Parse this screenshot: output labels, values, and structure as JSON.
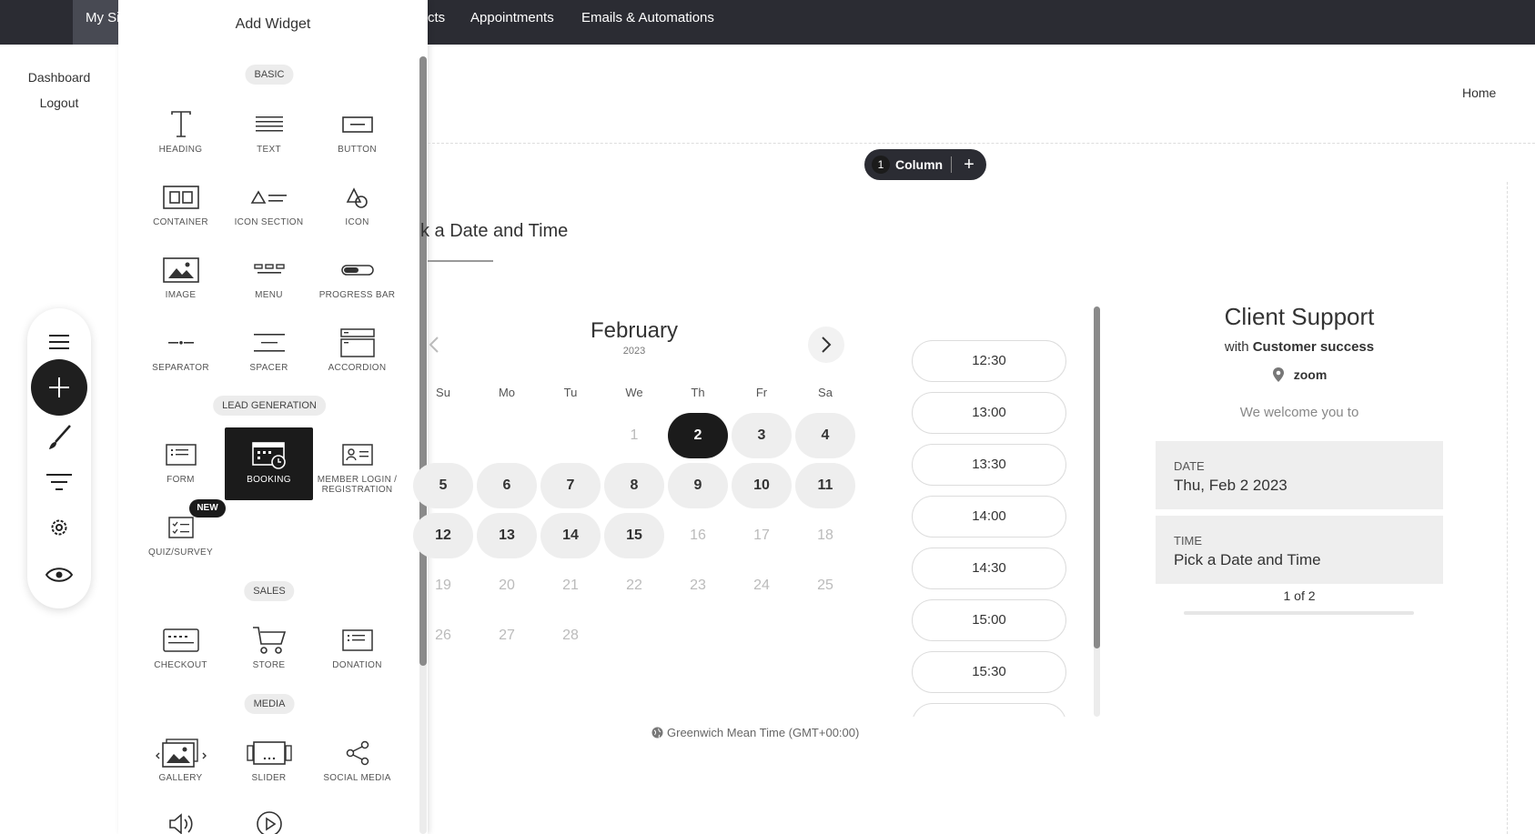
{
  "topbar": {
    "active_tab_label": "My Si",
    "partial_tab_label": "cts",
    "appointments_label": "Appointments",
    "emails_label": "Emails & Automations"
  },
  "left_links": {
    "dashboard": "Dashboard",
    "logout": "Logout"
  },
  "panel": {
    "title": "Add Widget",
    "sections": {
      "basic": "BASIC",
      "lead": "LEAD GENERATION",
      "sales": "SALES",
      "media": "MEDIA"
    },
    "widgets": {
      "heading": "HEADING",
      "text": "TEXT",
      "button": "BUTTON",
      "container": "CONTAINER",
      "icon_section": "ICON SECTION",
      "icon": "ICON",
      "image": "IMAGE",
      "menu": "MENU",
      "progress_bar": "PROGRESS BAR",
      "separator": "SEPARATOR",
      "spacer": "SPACER",
      "accordion": "ACCORDION",
      "form": "FORM",
      "booking": "BOOKING",
      "member_login": "MEMBER LOGIN / REGISTRATION",
      "quiz": "QUIZ/SURVEY",
      "checkout": "CHECKOUT",
      "store": "STORE",
      "donation": "DONATION",
      "gallery": "GALLERY",
      "slider": "SLIDER",
      "social_media": "SOCIAL MEDIA"
    },
    "new_badge": "NEW"
  },
  "page": {
    "home_link": "Home",
    "column_pill": {
      "count": "1",
      "label": "Column",
      "add": "+"
    },
    "pick_title": "k a Date and Time"
  },
  "calendar": {
    "month": "February",
    "year": "2023",
    "weekdays": [
      "Su",
      "Mo",
      "Tu",
      "We",
      "Th",
      "Fr",
      "Sa"
    ],
    "days": [
      "1",
      "2",
      "3",
      "4",
      "5",
      "6",
      "7",
      "8",
      "9",
      "10",
      "11",
      "12",
      "13",
      "14",
      "15",
      "16",
      "17",
      "18",
      "19",
      "20",
      "21",
      "22",
      "23",
      "24",
      "25",
      "26",
      "27",
      "28"
    ],
    "selected_day": "2"
  },
  "slots": [
    "12:30",
    "13:00",
    "13:30",
    "14:00",
    "14:30",
    "15:00",
    "15:30"
  ],
  "timezone": "Greenwich Mean Time (GMT+00:00)",
  "summary": {
    "title": "Client Support",
    "with_prefix": "with",
    "with_name": "Customer success",
    "location": "zoom",
    "welcome": "We welcome you to",
    "date_caption": "DATE",
    "date_value": "Thu, Feb 2 2023",
    "time_caption": "TIME",
    "time_value": "Pick a Date and Time",
    "pagination": "1 of 2"
  }
}
